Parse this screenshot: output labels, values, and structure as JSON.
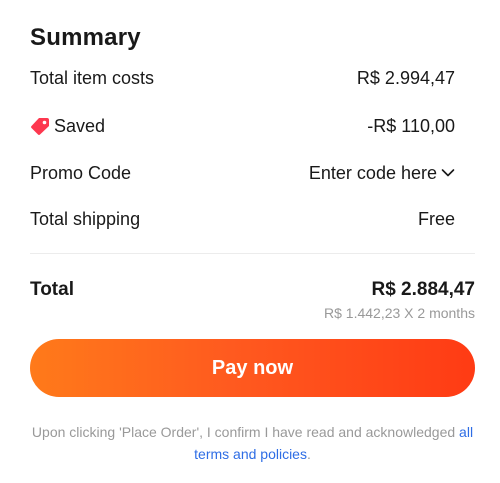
{
  "summary": {
    "title": "Summary",
    "total_item_costs": {
      "label": "Total item costs",
      "value": "R$ 2.994,47"
    },
    "saved": {
      "label": "Saved",
      "value": "-R$ 110,00",
      "color": "#fd384f"
    },
    "promo_code": {
      "label": "Promo Code",
      "value": "Enter code here"
    },
    "total_shipping": {
      "label": "Total shipping",
      "value": "Free"
    },
    "total": {
      "label": "Total",
      "value": "R$ 2.884,47",
      "installments": "R$ 1.442,23 X 2 months"
    },
    "pay_button": {
      "label": "Pay now",
      "gradient_start": "#ff7a1a",
      "gradient_end": "#ff3b14"
    },
    "notice": {
      "text": "Upon clicking 'Place Order', I confirm I have read and acknowledged",
      "link": "all terms and policies",
      "suffix": ".",
      "link_color": "#2e6de5"
    },
    "icons": {
      "saved": "price-tag-icon",
      "promo": "chevron-down-icon"
    }
  }
}
